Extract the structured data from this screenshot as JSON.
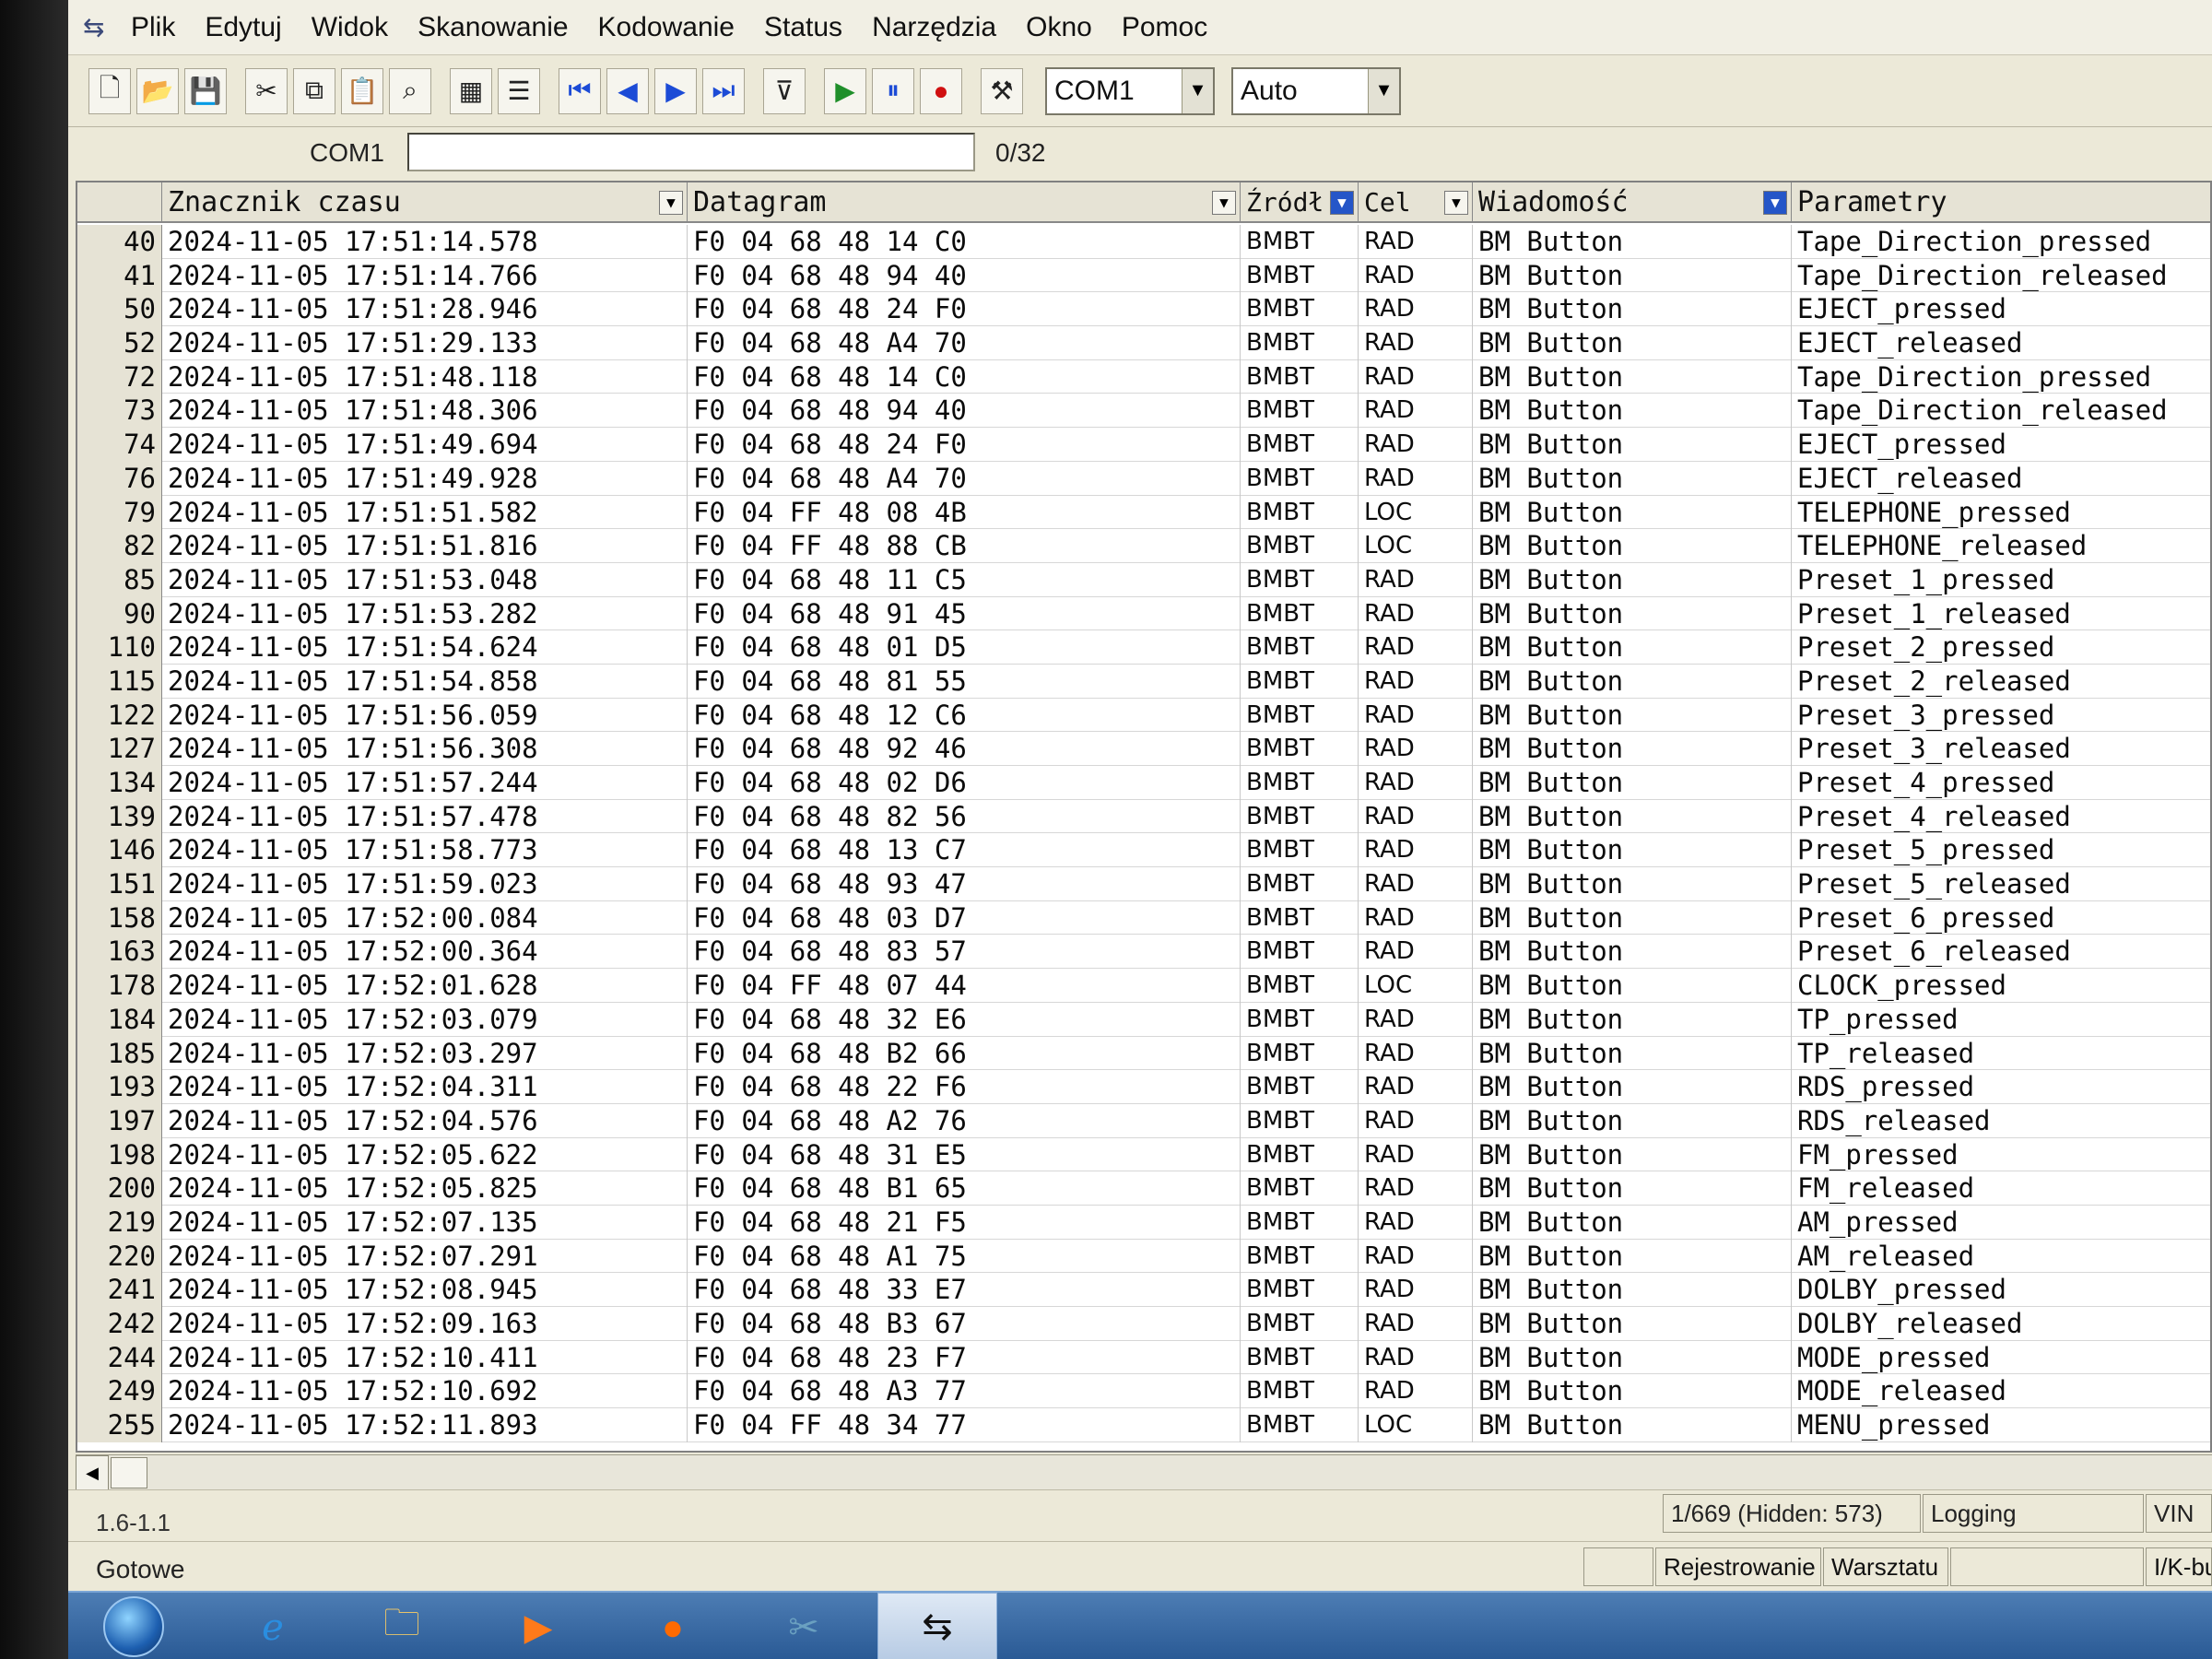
{
  "menu": [
    "Plik",
    "Edytuj",
    "Widok",
    "Skanowanie",
    "Kodowanie",
    "Status",
    "Narzędzia",
    "Okno",
    "Pomoc"
  ],
  "toolbar": {
    "port_combo": "COM1",
    "mode_combo": "Auto"
  },
  "port_row": {
    "label": "COM1",
    "count": "0/32"
  },
  "columns": {
    "timestamp": "Znacznik czasu",
    "datagram": "Datagram",
    "source": "Źródł",
    "target": "Cel",
    "message": "Wiadomość",
    "params": "Parametry"
  },
  "rows": [
    {
      "idx": "40",
      "ts": "2024-11-05 17:51:14.578",
      "dg": "F0 04 68 48 14 C0",
      "src": "BMBT",
      "dst": "RAD",
      "msg": "BM Button",
      "par": "Tape_Direction_pressed"
    },
    {
      "idx": "41",
      "ts": "2024-11-05 17:51:14.766",
      "dg": "F0 04 68 48 94 40",
      "src": "BMBT",
      "dst": "RAD",
      "msg": "BM Button",
      "par": "Tape_Direction_released"
    },
    {
      "idx": "50",
      "ts": "2024-11-05 17:51:28.946",
      "dg": "F0 04 68 48 24 F0",
      "src": "BMBT",
      "dst": "RAD",
      "msg": "BM Button",
      "par": "EJECT_pressed"
    },
    {
      "idx": "52",
      "ts": "2024-11-05 17:51:29.133",
      "dg": "F0 04 68 48 A4 70",
      "src": "BMBT",
      "dst": "RAD",
      "msg": "BM Button",
      "par": "EJECT_released"
    },
    {
      "idx": "72",
      "ts": "2024-11-05 17:51:48.118",
      "dg": "F0 04 68 48 14 C0",
      "src": "BMBT",
      "dst": "RAD",
      "msg": "BM Button",
      "par": "Tape_Direction_pressed"
    },
    {
      "idx": "73",
      "ts": "2024-11-05 17:51:48.306",
      "dg": "F0 04 68 48 94 40",
      "src": "BMBT",
      "dst": "RAD",
      "msg": "BM Button",
      "par": "Tape_Direction_released"
    },
    {
      "idx": "74",
      "ts": "2024-11-05 17:51:49.694",
      "dg": "F0 04 68 48 24 F0",
      "src": "BMBT",
      "dst": "RAD",
      "msg": "BM Button",
      "par": "EJECT_pressed"
    },
    {
      "idx": "76",
      "ts": "2024-11-05 17:51:49.928",
      "dg": "F0 04 68 48 A4 70",
      "src": "BMBT",
      "dst": "RAD",
      "msg": "BM Button",
      "par": "EJECT_released"
    },
    {
      "idx": "79",
      "ts": "2024-11-05 17:51:51.582",
      "dg": "F0 04 FF 48 08 4B",
      "src": "BMBT",
      "dst": "LOC",
      "msg": "BM Button",
      "par": "TELEPHONE_pressed"
    },
    {
      "idx": "82",
      "ts": "2024-11-05 17:51:51.816",
      "dg": "F0 04 FF 48 88 CB",
      "src": "BMBT",
      "dst": "LOC",
      "msg": "BM Button",
      "par": "TELEPHONE_released"
    },
    {
      "idx": "85",
      "ts": "2024-11-05 17:51:53.048",
      "dg": "F0 04 68 48 11 C5",
      "src": "BMBT",
      "dst": "RAD",
      "msg": "BM Button",
      "par": "Preset_1_pressed"
    },
    {
      "idx": "90",
      "ts": "2024-11-05 17:51:53.282",
      "dg": "F0 04 68 48 91 45",
      "src": "BMBT",
      "dst": "RAD",
      "msg": "BM Button",
      "par": "Preset_1_released"
    },
    {
      "idx": "110",
      "ts": "2024-11-05 17:51:54.624",
      "dg": "F0 04 68 48 01 D5",
      "src": "BMBT",
      "dst": "RAD",
      "msg": "BM Button",
      "par": "Preset_2_pressed"
    },
    {
      "idx": "115",
      "ts": "2024-11-05 17:51:54.858",
      "dg": "F0 04 68 48 81 55",
      "src": "BMBT",
      "dst": "RAD",
      "msg": "BM Button",
      "par": "Preset_2_released"
    },
    {
      "idx": "122",
      "ts": "2024-11-05 17:51:56.059",
      "dg": "F0 04 68 48 12 C6",
      "src": "BMBT",
      "dst": "RAD",
      "msg": "BM Button",
      "par": "Preset_3_pressed"
    },
    {
      "idx": "127",
      "ts": "2024-11-05 17:51:56.308",
      "dg": "F0 04 68 48 92 46",
      "src": "BMBT",
      "dst": "RAD",
      "msg": "BM Button",
      "par": "Preset_3_released"
    },
    {
      "idx": "134",
      "ts": "2024-11-05 17:51:57.244",
      "dg": "F0 04 68 48 02 D6",
      "src": "BMBT",
      "dst": "RAD",
      "msg": "BM Button",
      "par": "Preset_4_pressed"
    },
    {
      "idx": "139",
      "ts": "2024-11-05 17:51:57.478",
      "dg": "F0 04 68 48 82 56",
      "src": "BMBT",
      "dst": "RAD",
      "msg": "BM Button",
      "par": "Preset_4_released"
    },
    {
      "idx": "146",
      "ts": "2024-11-05 17:51:58.773",
      "dg": "F0 04 68 48 13 C7",
      "src": "BMBT",
      "dst": "RAD",
      "msg": "BM Button",
      "par": "Preset_5_pressed"
    },
    {
      "idx": "151",
      "ts": "2024-11-05 17:51:59.023",
      "dg": "F0 04 68 48 93 47",
      "src": "BMBT",
      "dst": "RAD",
      "msg": "BM Button",
      "par": "Preset_5_released"
    },
    {
      "idx": "158",
      "ts": "2024-11-05 17:52:00.084",
      "dg": "F0 04 68 48 03 D7",
      "src": "BMBT",
      "dst": "RAD",
      "msg": "BM Button",
      "par": "Preset_6_pressed"
    },
    {
      "idx": "163",
      "ts": "2024-11-05 17:52:00.364",
      "dg": "F0 04 68 48 83 57",
      "src": "BMBT",
      "dst": "RAD",
      "msg": "BM Button",
      "par": "Preset_6_released"
    },
    {
      "idx": "178",
      "ts": "2024-11-05 17:52:01.628",
      "dg": "F0 04 FF 48 07 44",
      "src": "BMBT",
      "dst": "LOC",
      "msg": "BM Button",
      "par": "CLOCK_pressed"
    },
    {
      "idx": "184",
      "ts": "2024-11-05 17:52:03.079",
      "dg": "F0 04 68 48 32 E6",
      "src": "BMBT",
      "dst": "RAD",
      "msg": "BM Button",
      "par": "TP_pressed"
    },
    {
      "idx": "185",
      "ts": "2024-11-05 17:52:03.297",
      "dg": "F0 04 68 48 B2 66",
      "src": "BMBT",
      "dst": "RAD",
      "msg": "BM Button",
      "par": "TP_released"
    },
    {
      "idx": "193",
      "ts": "2024-11-05 17:52:04.311",
      "dg": "F0 04 68 48 22 F6",
      "src": "BMBT",
      "dst": "RAD",
      "msg": "BM Button",
      "par": "RDS_pressed"
    },
    {
      "idx": "197",
      "ts": "2024-11-05 17:52:04.576",
      "dg": "F0 04 68 48 A2 76",
      "src": "BMBT",
      "dst": "RAD",
      "msg": "BM Button",
      "par": "RDS_released"
    },
    {
      "idx": "198",
      "ts": "2024-11-05 17:52:05.622",
      "dg": "F0 04 68 48 31 E5",
      "src": "BMBT",
      "dst": "RAD",
      "msg": "BM Button",
      "par": "FM_pressed"
    },
    {
      "idx": "200",
      "ts": "2024-11-05 17:52:05.825",
      "dg": "F0 04 68 48 B1 65",
      "src": "BMBT",
      "dst": "RAD",
      "msg": "BM Button",
      "par": "FM_released"
    },
    {
      "idx": "219",
      "ts": "2024-11-05 17:52:07.135",
      "dg": "F0 04 68 48 21 F5",
      "src": "BMBT",
      "dst": "RAD",
      "msg": "BM Button",
      "par": "AM_pressed"
    },
    {
      "idx": "220",
      "ts": "2024-11-05 17:52:07.291",
      "dg": "F0 04 68 48 A1 75",
      "src": "BMBT",
      "dst": "RAD",
      "msg": "BM Button",
      "par": "AM_released"
    },
    {
      "idx": "241",
      "ts": "2024-11-05 17:52:08.945",
      "dg": "F0 04 68 48 33 E7",
      "src": "BMBT",
      "dst": "RAD",
      "msg": "BM Button",
      "par": "DOLBY_pressed"
    },
    {
      "idx": "242",
      "ts": "2024-11-05 17:52:09.163",
      "dg": "F0 04 68 48 B3 67",
      "src": "BMBT",
      "dst": "RAD",
      "msg": "BM Button",
      "par": "DOLBY_released"
    },
    {
      "idx": "244",
      "ts": "2024-11-05 17:52:10.411",
      "dg": "F0 04 68 48 23 F7",
      "src": "BMBT",
      "dst": "RAD",
      "msg": "BM Button",
      "par": "MODE_pressed"
    },
    {
      "idx": "249",
      "ts": "2024-11-05 17:52:10.692",
      "dg": "F0 04 68 48 A3 77",
      "src": "BMBT",
      "dst": "RAD",
      "msg": "BM Button",
      "par": "MODE_released"
    },
    {
      "idx": "255",
      "ts": "2024-11-05 17:52:11.893",
      "dg": "F0 04 FF 48 34 77",
      "src": "BMBT",
      "dst": "LOC",
      "msg": "BM Button",
      "par": "MENU_pressed"
    }
  ],
  "info": {
    "version": "1.6-1.1",
    "record_count": "1/669 (Hidden: 573)",
    "logging": "Logging",
    "vin": "VIN"
  },
  "status": {
    "ready": "Gotowe",
    "registering": "Rejestrowanie",
    "workshop": "Warsztatu",
    "ik_bus": "I/K-bus"
  }
}
